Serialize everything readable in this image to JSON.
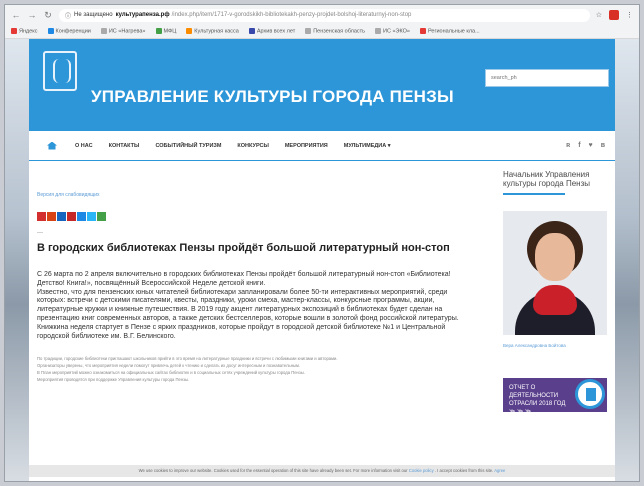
{
  "browser": {
    "url_prefix": "Не защищено",
    "url_domain": "культурапенза.рф",
    "url_rest": "/index.php/item/1717-v-gorodskikh-bibliotekakh-penzy-projdet-bolshoj-literaturnyj-non-stop",
    "bookmarks": [
      "Яндекс",
      "Конференции",
      "ИС «Нагрева»",
      "МФЦ",
      "Культурная касса",
      "Архив всех лет",
      "Пензенская область",
      "ИС «ЭКО»",
      "Региональные кла..."
    ]
  },
  "site": {
    "title": "УПРАВЛЕНИЕ КУЛЬТУРЫ ГОРОДА ПЕНЗЫ",
    "search_placeholder": "search_ph",
    "nav": [
      "О НАС",
      "КОНТАКТЫ",
      "СОБЫТИЙНЫЙ ТУРИЗМ",
      "КОНКУРСЫ",
      "МЕРОПРИЯТИЯ",
      "МУЛЬТИМЕДИА ▾"
    ],
    "social_icons": [
      "rss-icon",
      "facebook-icon",
      "twitter-icon",
      "vk-icon"
    ]
  },
  "article": {
    "breadcrumb": "Версия для слабовидящих",
    "dash": "—",
    "title": "В городских библиотеках Пензы пройдёт большой литературный нон-стоп",
    "paragraphs": [
      "С 26 марта по 2 апреля включительно в городских библиотеках Пензы пройдёт большой литературный нон-стоп «Библиотека! Детство! Книга!», посвящённый Всероссийской Неделе детской книги.",
      "Известно, что для пензенских юных читателей библиотекари запланировали более 50-ти интерактивных мероприятий, среди которых: встречи с детскими писателями, квесты, праздники, уроки смеха, мастер-классы, конкурсные программы, акции, литературные кружки и книжные путешествия. В 2019 году акцент литературных экспозиций в библиотеках будет сделан на презентацию книг современных авторов, а также детских бестселлеров, которые вошли в золотой фонд российской литературы.",
      "Книжкина неделя стартует в Пензе с ярких праздников, которые пройдут в городской детской библиотеке №1 и Центральной городской библиотеке им. В.Г. Белинского."
    ],
    "small_lines": [
      "По традиции, городские библиотеки приглашают школьников прийти в это время на литературные праздники и встречи с любимыми книгами и авторами.",
      "Организаторы уверены, что мероприятия недели помогут привлечь детей к чтению и сделать их досуг интересным и познавательным.",
      "В План мероприятий можно ознакомиться на официальных сайтах библиотек и в социальных сетях учреждений культуры города Пензы.",
      "Мероприятия проводятся при поддержке Управления культуры города Пензы."
    ]
  },
  "sidebar": {
    "heading": "Начальник Управления культуры города Пензы",
    "caption": "Вера Александровна Бойтова",
    "banner_text": "ОТЧЕТ О ДЕЯТЕЛЬНОСТИ ОТРАСЛИ 2018 ГОД ≫ ≫ ≫"
  },
  "cookie": {
    "text": "We use cookies to improve our website. Cookies used for the essential operation of this site have already been set. For more information visit our",
    "link1": "Cookie policy",
    "text2": ". I accept cookies from this site.",
    "link2": "Agree"
  },
  "colors": {
    "brand_blue": "#2d96d8",
    "banner_purple": "#5a3f8c"
  }
}
